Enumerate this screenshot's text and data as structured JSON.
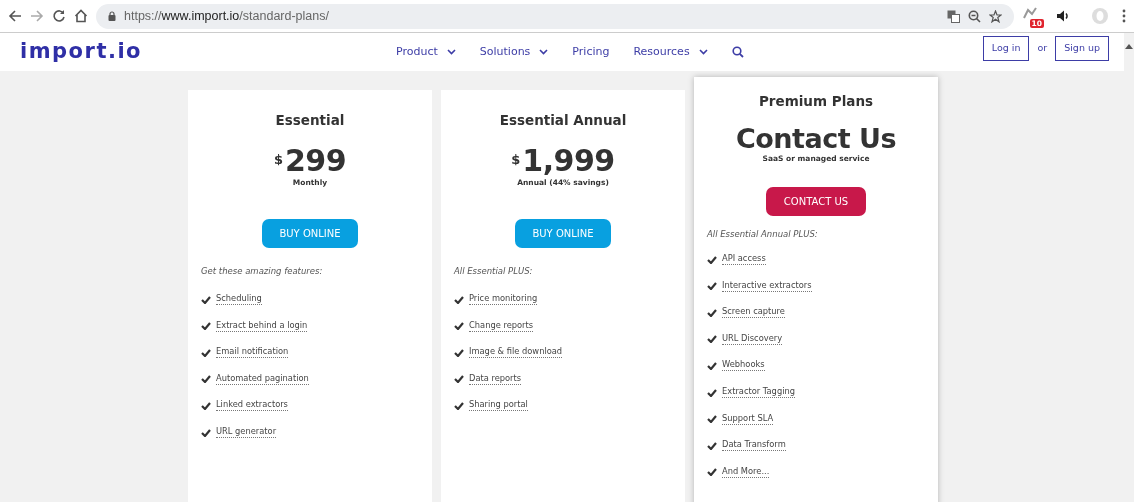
{
  "browser": {
    "url": {
      "scheme": "https://",
      "host": "www.import.io",
      "path": "/standard-plans/"
    },
    "extension_badge": "10"
  },
  "navbar": {
    "logo": "import.io",
    "menu": [
      {
        "label": "Product",
        "dropdown": true
      },
      {
        "label": "Solutions",
        "dropdown": true
      },
      {
        "label": "Pricing",
        "dropdown": false
      },
      {
        "label": "Resources",
        "dropdown": true
      }
    ],
    "login": "Log in",
    "or": "or",
    "signup": "Sign up"
  },
  "plans": [
    {
      "title": "Essential",
      "featured": false,
      "currency": "$",
      "price": "299",
      "period": "Monthly",
      "button": {
        "label": "BUY ONLINE",
        "kind": "buy"
      },
      "intro": "Get these amazing features:",
      "features": [
        "Scheduling",
        "Extract behind a login",
        "Email notification",
        "Automated pagination",
        "Linked extractors",
        "URL generator"
      ]
    },
    {
      "title": "Essential Annual",
      "featured": false,
      "currency": "$",
      "price": "1,999",
      "period": "Annual (44% savings)",
      "button": {
        "label": "BUY ONLINE",
        "kind": "buy"
      },
      "intro": "All Essential PLUS:",
      "features": [
        "Price monitoring",
        "Change reports",
        "Image & file download",
        "Data reports",
        "Sharing portal"
      ]
    },
    {
      "title": "Premium Plans",
      "featured": true,
      "price": "Contact Us",
      "period": "SaaS or managed service",
      "button": {
        "label": "CONTACT US",
        "kind": "contact"
      },
      "intro": "All Essential Annual PLUS:",
      "features": [
        "API access",
        "Interactive extractors",
        "Screen capture",
        "URL Discovery",
        "Webhooks",
        "Extractor Tagging",
        "Support SLA",
        "Data Transform",
        "And More..."
      ]
    }
  ]
}
